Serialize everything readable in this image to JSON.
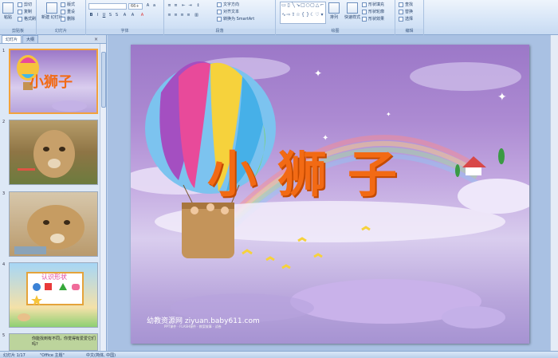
{
  "ribbon": {
    "clipboard": {
      "paste": "粘贴",
      "cut": "剪切",
      "copy": "复制",
      "format_painter": "格式刷",
      "label": "剪贴板"
    },
    "slides": {
      "new_slide": "新建\n幻灯片",
      "layout": "版式",
      "reset": "重设",
      "delete": "删除",
      "label": "幻灯片"
    },
    "font": {
      "font_name": "",
      "font_size": "66+",
      "label": "字体"
    },
    "paragraph": {
      "text_direction": "文字方向",
      "align_text": "对齐文本",
      "smartart": "转换为 SmartArt",
      "label": "段落"
    },
    "drawing": {
      "arrange": "排列",
      "quick_styles": "快速样式",
      "shape_fill": "形状填充",
      "shape_outline": "形状轮廓",
      "shape_effects": "形状效果",
      "label": "绘图"
    },
    "editing": {
      "find": "查找",
      "replace": "替换",
      "select": "选择",
      "label": "编辑"
    }
  },
  "thumbpane": {
    "tabs": [
      "幻灯片",
      "大纲"
    ],
    "close": "×",
    "slides": [
      {
        "num": "1",
        "selected": true,
        "title": "小狮子"
      },
      {
        "num": "2",
        "selected": false,
        "title": ""
      },
      {
        "num": "3",
        "selected": false,
        "title": ""
      },
      {
        "num": "4",
        "selected": false,
        "title": "认识形状"
      },
      {
        "num": "5",
        "selected": false,
        "caption": "你能找到有不同，你觉得有爱爱它们吗?"
      }
    ]
  },
  "slide": {
    "title": "小狮子",
    "watermark": "幼教资源网 ziyuan.baby611.com",
    "watermark_sub": "PPT课件 · FLASH课件 · 教案故事 · 试卷"
  },
  "statusbar": {
    "slide_count": "幻灯片 1/17",
    "theme": "\"Office 主题\"",
    "language": "中文(简体, 中国)"
  },
  "colors": {
    "title": "#f26a14",
    "ribbon": "#d6e5f7",
    "selection": "#f2a23c"
  }
}
